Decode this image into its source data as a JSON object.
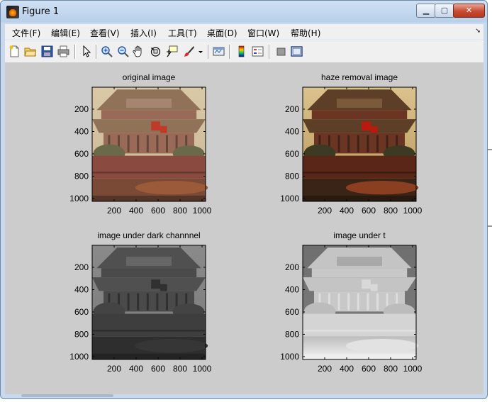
{
  "window": {
    "title": "Figure 1",
    "buttons": {
      "minimize": "▁",
      "maximize": "▢",
      "close": "✕"
    }
  },
  "menu": [
    "文件(F)",
    "编辑(E)",
    "查看(V)",
    "插入(I)",
    "工具(T)",
    "桌面(D)",
    "窗口(W)",
    "帮助(H)"
  ],
  "toolbar_icons": [
    "new-figure-icon",
    "open-icon",
    "save-icon",
    "print-icon",
    "pointer-icon",
    "zoom-in-icon",
    "zoom-out-icon",
    "pan-hand-icon",
    "rotate-3d-icon",
    "data-cursor-icon",
    "brush-icon",
    "brush-dropdown-icon",
    "link-plot-icon",
    "colorbar-icon",
    "legend-icon",
    "hide-plot-tools-icon",
    "show-plot-tools-icon"
  ],
  "subplots": [
    {
      "title": "original image",
      "style": "hazy-color"
    },
    {
      "title": "haze removal image",
      "style": "dehazed-color"
    },
    {
      "title": "image under dark channnel",
      "style": "dark-channel"
    },
    {
      "title": "image under t",
      "style": "transmission"
    }
  ],
  "y_ticks": [
    "200",
    "400",
    "600",
    "800",
    "1000"
  ],
  "x_ticks": [
    "200",
    "400",
    "600",
    "800",
    "1000"
  ]
}
